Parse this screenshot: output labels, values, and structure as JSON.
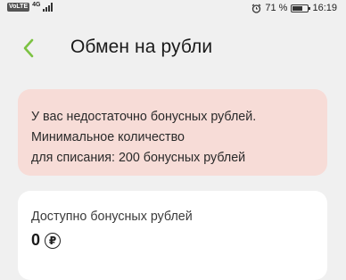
{
  "status_bar": {
    "volte": "VoLTE",
    "network": "4G",
    "battery_percent": "71 %",
    "battery_level": 0.71,
    "time": "16:19",
    "icons": [
      "alarm-icon",
      "battery-icon",
      "signal-icon"
    ]
  },
  "header": {
    "title": "Обмен на рубли",
    "back_icon": "chevron-left-icon",
    "accent_color": "#7cc242"
  },
  "alert": {
    "lines": [
      "У вас недостаточно бонусных рублей.",
      "Минимальное количество",
      "для списания: 200 бонусных рублей"
    ],
    "background": "#f7dcd7"
  },
  "balance": {
    "label": "Доступно бонусных рублей",
    "value": "0",
    "currency_symbol": "₽",
    "currency_icon": "ruble-icon"
  }
}
